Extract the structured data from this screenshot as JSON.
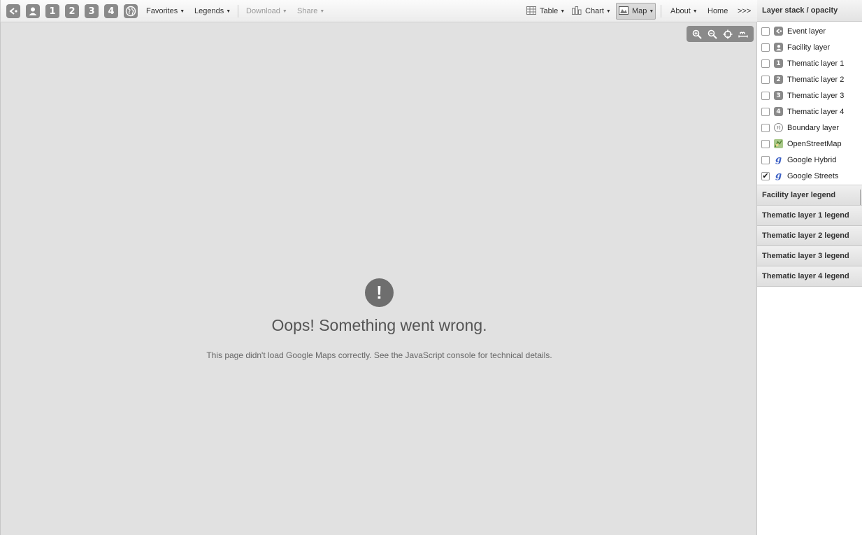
{
  "toolbar": {
    "layer_buttons": [
      "1",
      "2",
      "3",
      "4"
    ],
    "favorites": "Favorites",
    "legends": "Legends",
    "download": "Download",
    "share": "Share",
    "table": "Table",
    "chart": "Chart",
    "map": "Map",
    "about": "About",
    "home": "Home",
    "more": ">>>"
  },
  "map": {
    "error_icon": "!",
    "error_title": "Oops! Something went wrong.",
    "error_text": "This page didn't load Google Maps correctly. See the JavaScript console for technical details."
  },
  "panel": {
    "title": "Layer stack / opacity",
    "layers": [
      {
        "label": "Event layer",
        "icon": "event-icon",
        "checked": false
      },
      {
        "label": "Facility layer",
        "icon": "facility-icon",
        "checked": false
      },
      {
        "label": "Thematic layer 1",
        "icon": "1",
        "checked": false
      },
      {
        "label": "Thematic layer 2",
        "icon": "2",
        "checked": false
      },
      {
        "label": "Thematic layer 3",
        "icon": "3",
        "checked": false
      },
      {
        "label": "Thematic layer 4",
        "icon": "4",
        "checked": false
      },
      {
        "label": "Boundary layer",
        "icon": "boundary-icon",
        "checked": false
      },
      {
        "label": "OpenStreetMap",
        "icon": "osm-icon",
        "checked": false
      },
      {
        "label": "Google Hybrid",
        "icon": "g",
        "checked": false
      },
      {
        "label": "Google Streets",
        "icon": "g",
        "checked": true
      }
    ],
    "legends": [
      "Facility layer legend",
      "Thematic layer 1 legend",
      "Thematic layer 2 legend",
      "Thematic layer 3 legend",
      "Thematic layer 4 legend"
    ],
    "checkmark": "✔"
  },
  "colors": {
    "button_gray": "#8a8a8a",
    "map_background": "#e1e1e1"
  }
}
